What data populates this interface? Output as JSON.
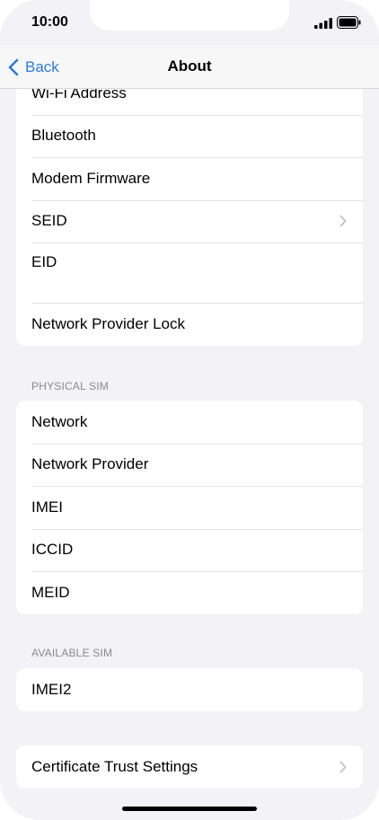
{
  "status_bar": {
    "time": "10:00"
  },
  "nav": {
    "back_label": "Back",
    "title": "About"
  },
  "group1": {
    "items": [
      {
        "label": "Wi-Fi Address"
      },
      {
        "label": "Bluetooth"
      },
      {
        "label": "Modem Firmware"
      },
      {
        "label": "SEID"
      },
      {
        "label": "EID"
      },
      {
        "label": "Network Provider Lock"
      }
    ]
  },
  "physical_sim": {
    "header": "PHYSICAL SIM",
    "items": [
      {
        "label": "Network"
      },
      {
        "label": "Network Provider"
      },
      {
        "label": "IMEI"
      },
      {
        "label": "ICCID"
      },
      {
        "label": "MEID"
      }
    ]
  },
  "available_sim": {
    "header": "AVAILABLE SIM",
    "items": [
      {
        "label": "IMEI2"
      }
    ]
  },
  "certificate": {
    "label": "Certificate Trust Settings"
  },
  "colors": {
    "accent": "#2b7bd8",
    "background": "#f2f2f7",
    "separator": "#e2e2e6"
  },
  "icons": [
    "signal-icon",
    "battery-icon",
    "chevron-left-icon",
    "chevron-right-icon"
  ]
}
